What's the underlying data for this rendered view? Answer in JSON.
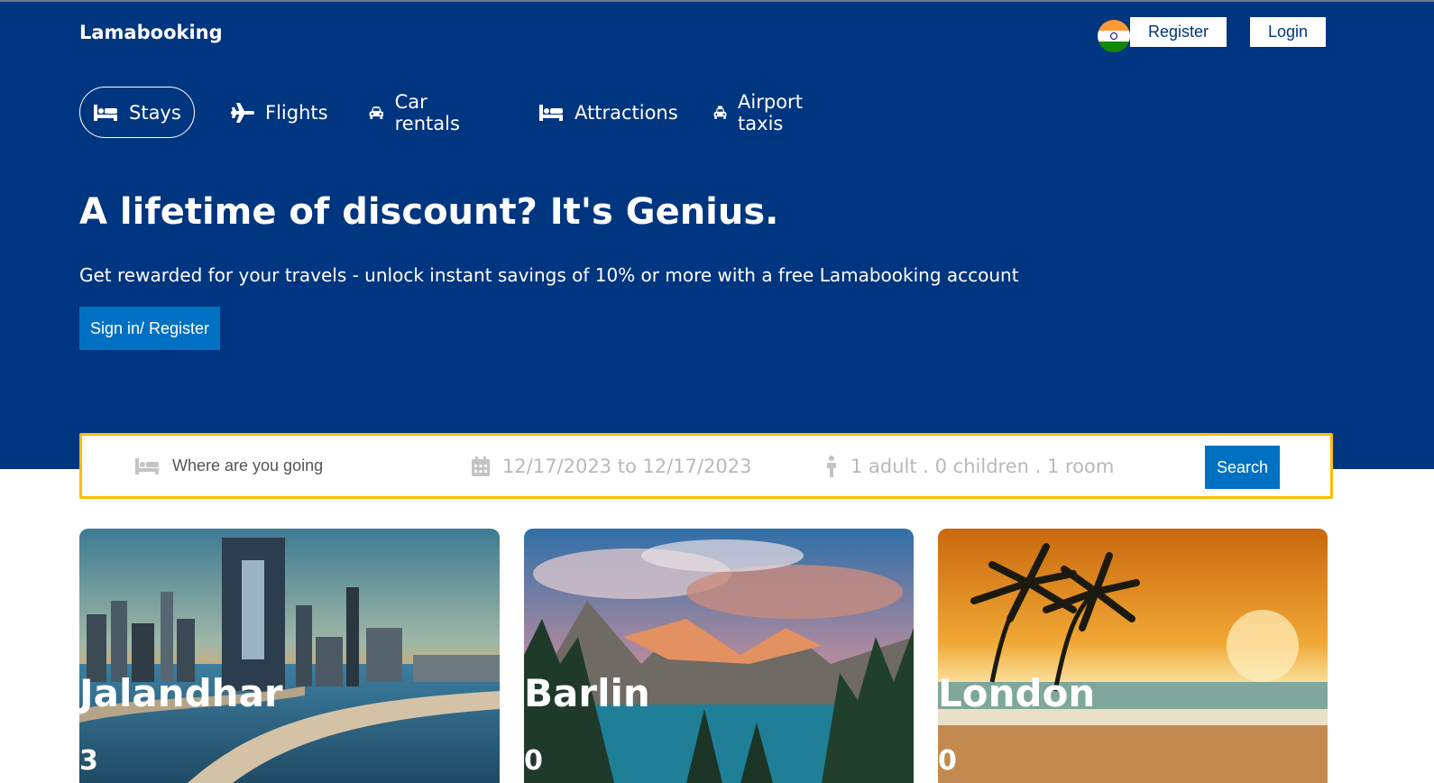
{
  "header": {
    "logo": "Lamabooking",
    "register_label": "Register",
    "login_label": "Login"
  },
  "nav": [
    {
      "label": "Stays",
      "icon": "bed-icon",
      "active": true
    },
    {
      "label": "Flights",
      "icon": "plane-icon",
      "active": false
    },
    {
      "label": "Car rentals",
      "icon": "car-icon",
      "active": false
    },
    {
      "label": "Attractions",
      "icon": "bed-icon",
      "active": false
    },
    {
      "label": "Airport taxis",
      "icon": "taxi-icon",
      "active": false
    }
  ],
  "hero": {
    "title": "A lifetime of discount? It's Genius.",
    "subtitle": "Get rewarded for your travels - unlock instant savings of 10% or more with a free Lamabooking account",
    "cta_label": "Sign in/ Register"
  },
  "search": {
    "destination_placeholder": "Where are you going",
    "dates": "12/17/2023 to 12/17/2023",
    "guests": "1 adult . 0 children . 1 room",
    "button_label": "Search"
  },
  "cities": [
    {
      "name": "Jalandhar",
      "count": "3"
    },
    {
      "name": "Barlin",
      "count": "0"
    },
    {
      "name": "London",
      "count": "0"
    }
  ],
  "colors": {
    "header_bg": "#003580",
    "primary_button": "#0071c2",
    "search_border": "#febb02"
  }
}
